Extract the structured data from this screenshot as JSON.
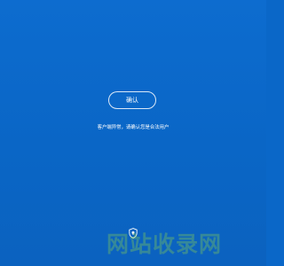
{
  "dialog": {
    "confirm_label": "确认",
    "message": "客户端异常，请确认您是合法用户"
  },
  "watermark": {
    "text": "网站收录网"
  },
  "icons": {
    "shield": "shield-icon"
  },
  "colors": {
    "background": "#0a67c8",
    "text": "#ffffff",
    "watermark": "#7ec85a"
  }
}
